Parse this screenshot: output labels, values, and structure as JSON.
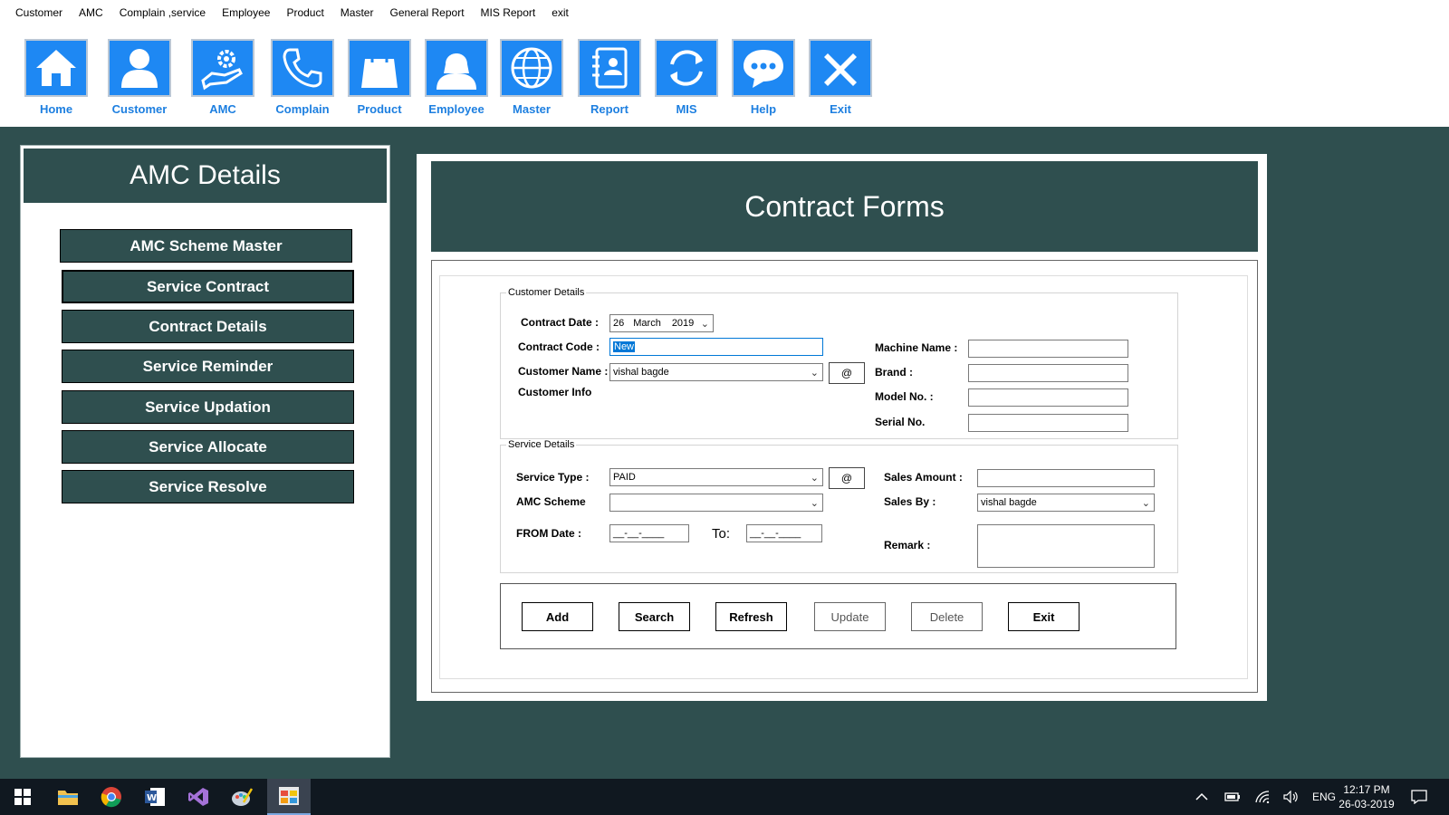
{
  "menu": [
    "Customer",
    "AMC",
    "Complain ,service",
    "Employee",
    "Product",
    "Master",
    "General Report",
    "MIS Report",
    "exit"
  ],
  "toolbar": [
    {
      "label": "Home",
      "icon": "home-icon"
    },
    {
      "label": "Customer",
      "icon": "person-icon"
    },
    {
      "label": "AMC",
      "icon": "hand-gear-icon"
    },
    {
      "label": "Complain",
      "icon": "phone-icon"
    },
    {
      "label": "Product",
      "icon": "shopping-bag-icon"
    },
    {
      "label": "Employee",
      "icon": "woman-icon"
    },
    {
      "label": "Master",
      "icon": "globe-icon"
    },
    {
      "label": "Report",
      "icon": "contact-book-icon"
    },
    {
      "label": "MIS",
      "icon": "refresh-icon"
    },
    {
      "label": "Help",
      "icon": "chat-bubble-icon"
    },
    {
      "label": "Exit",
      "icon": "close-icon"
    }
  ],
  "left_panel": {
    "title": "AMC Details",
    "buttons": [
      "AMC Scheme Master",
      "Service Contract",
      "Contract Details",
      "Service Reminder",
      "Service Updation",
      "Service Allocate",
      "Service Resolve"
    ]
  },
  "right_panel": {
    "title": "Contract Forms",
    "customer_details": {
      "legend": "Customer Details",
      "contract_date_label": "Contract Date :",
      "contract_date": {
        "day": "26",
        "month": "March",
        "year": "2019"
      },
      "contract_code_label": "Contract Code :",
      "contract_code_value": "New",
      "customer_name_label": "Customer Name :",
      "customer_name_value": "vishal  bagde",
      "customer_info_label": "Customer Info",
      "at_label": "@",
      "machine_name_label": "Machine Name :",
      "brand_label": "Brand :",
      "model_label": "Model No. :",
      "serial_label": "Serial No."
    },
    "service_details": {
      "legend": "Service Details",
      "service_type_label": "Service Type :",
      "service_type_value": "PAID",
      "at_label": "@",
      "amc_scheme_label": "AMC Scheme",
      "amc_scheme_value": "",
      "from_date_label": "FROM Date :",
      "from_date_value": "__-__-____",
      "to_label": "To:",
      "to_date_value": "__-__-____",
      "sales_amount_label": "Sales Amount :",
      "sales_by_label": "Sales By :",
      "sales_by_value": "vishal bagde",
      "remark_label": "Remark :"
    },
    "actions": [
      "Add",
      "Search",
      "Refresh",
      "Update",
      "Delete",
      "Exit"
    ]
  },
  "taskbar": {
    "lang": "ENG",
    "time": "12:17 PM",
    "date": "26-03-2019"
  }
}
